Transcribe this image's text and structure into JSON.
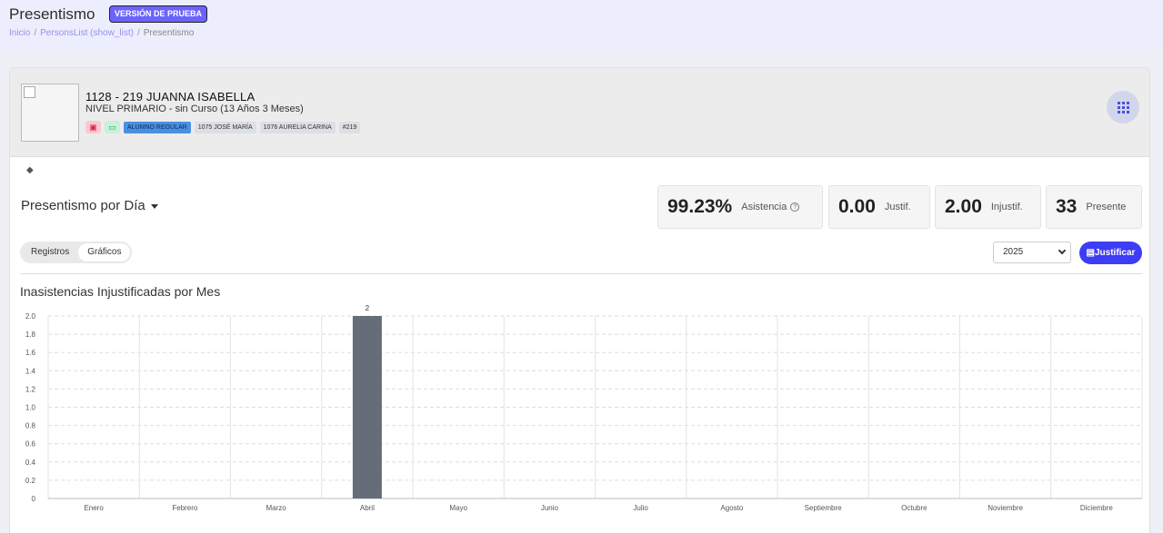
{
  "header": {
    "title": "Presentismo",
    "badge": "VERSIÓN DE PRUEBA",
    "breadcrumb": [
      "Inicio",
      "PersonsList (show_list)",
      "Presentismo"
    ]
  },
  "person": {
    "name": "1128 - 219 JUANNA ISABELLA",
    "subtitle": "NIVEL PRIMARIO - sin Curso (13 Años 3 Meses)",
    "tags": [
      "ALUMNO REGULAR",
      "1075 JOSÉ MARÍA",
      "1076 AURELIA CARINA",
      "#219"
    ]
  },
  "section": {
    "title": "Presentismo por Día"
  },
  "stats": [
    {
      "value": "99.23%",
      "label": "Asistencia"
    },
    {
      "value": "0.00",
      "label": "Justif."
    },
    {
      "value": "2.00",
      "label": "Injustif."
    },
    {
      "value": "33",
      "label": "Presente"
    }
  ],
  "tabs": [
    "Registros",
    "Gráficos"
  ],
  "year": "2025",
  "justify_button": "Justificar",
  "chart_data": {
    "type": "bar",
    "title": "Inasistencias Injustificadas por Mes",
    "categories": [
      "Enero",
      "Febrero",
      "Marzo",
      "Abril",
      "Mayo",
      "Junio",
      "Julio",
      "Agosto",
      "Septiembre",
      "Octubre",
      "Noviembre",
      "Diciembre"
    ],
    "values": [
      0,
      0,
      0,
      2,
      0,
      0,
      0,
      0,
      0,
      0,
      0,
      0
    ],
    "data_labels": [
      "",
      "",
      "",
      "2",
      "",
      "",
      "",
      "",
      "",
      "",
      "",
      ""
    ],
    "yticks": [
      "0",
      "0.2",
      "0.4",
      "0.6",
      "0.8",
      "1.0",
      "1.2",
      "1.4",
      "1.6",
      "1.8",
      "2.0"
    ],
    "ylim": [
      0,
      2
    ],
    "bar_color": "#646d78",
    "grid": true
  }
}
